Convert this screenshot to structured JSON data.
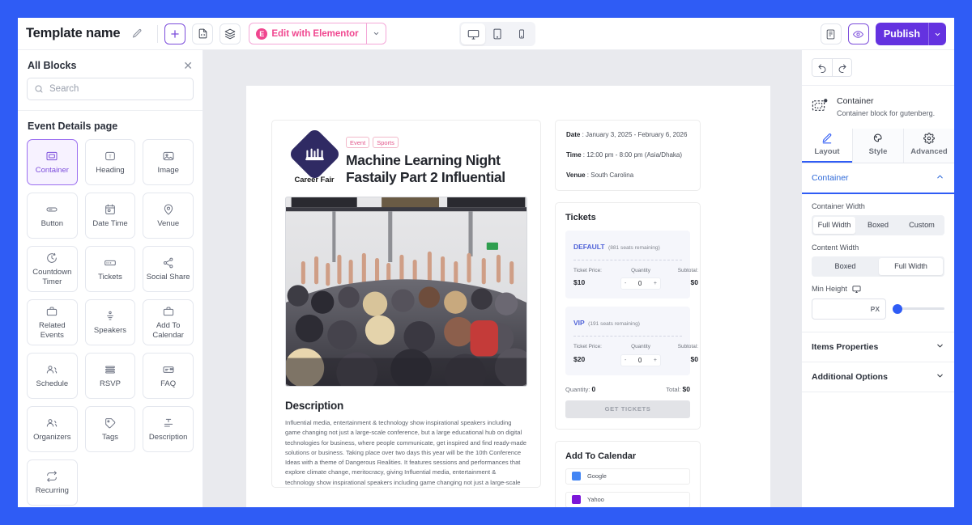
{
  "topbar": {
    "template_name": "Template name",
    "edit_pencil_icon": "pencil-icon",
    "add_icon": "plus-icon",
    "template_icon": "file-code-icon",
    "layers_icon": "layers-icon",
    "elementor_label": "Edit with Elementor",
    "elementor_badge": "E",
    "elementor_caret_icon": "chevron-down-icon",
    "devices": [
      {
        "name": "desktop",
        "icon": "desktop-icon",
        "active": true
      },
      {
        "name": "tablet",
        "icon": "tablet-icon",
        "active": false
      },
      {
        "name": "mobile",
        "icon": "mobile-icon",
        "active": false
      }
    ],
    "list_view_icon": "list-view-icon",
    "preview_icon": "eye-icon",
    "publish_label": "Publish",
    "publish_caret_icon": "chevron-down-icon",
    "accent_purple": "#6432e0",
    "accent_pink": "#f0468f"
  },
  "left_sidebar": {
    "title": "All Blocks",
    "close_icon": "close-icon",
    "search": {
      "placeholder": "Search",
      "value": "",
      "icon": "search-icon"
    },
    "section_title": "Event Details page",
    "blocks": [
      {
        "label": "Container",
        "icon": "container-icon",
        "active": true
      },
      {
        "label": "Heading",
        "icon": "heading-icon",
        "active": false
      },
      {
        "label": "Image",
        "icon": "image-icon",
        "active": false
      },
      {
        "label": "Button",
        "icon": "button-icon",
        "active": false
      },
      {
        "label": "Date Time",
        "icon": "calendar-icon",
        "active": false
      },
      {
        "label": "Venue",
        "icon": "pin-icon",
        "active": false
      },
      {
        "label": "Countdown Timer",
        "icon": "clock-icon",
        "active": false
      },
      {
        "label": "Tickets",
        "icon": "ticket-icon",
        "active": false
      },
      {
        "label": "Social Share",
        "icon": "share-icon",
        "active": false
      },
      {
        "label": "Related Events",
        "icon": "briefcase-icon",
        "active": false
      },
      {
        "label": "Speakers",
        "icon": "speaker-icon",
        "active": false
      },
      {
        "label": "Add To Calendar",
        "icon": "briefcase-icon",
        "active": false
      },
      {
        "label": "Schedule",
        "icon": "people-icon",
        "active": false
      },
      {
        "label": "RSVP",
        "icon": "list-icon",
        "active": false
      },
      {
        "label": "FAQ",
        "icon": "faq-icon",
        "active": false
      },
      {
        "label": "Organizers",
        "icon": "people-icon",
        "active": false
      },
      {
        "label": "Tags",
        "icon": "tag-icon",
        "active": false
      },
      {
        "label": "Description",
        "icon": "text-icon",
        "active": false
      },
      {
        "label": "Recurring",
        "icon": "repeat-icon",
        "active": false
      }
    ]
  },
  "canvas": {
    "event": {
      "logo_text": "Career Fair",
      "logo_icon": "crown-diamond-logo",
      "tags": [
        "Event",
        "Sports"
      ],
      "title": "Machine Learning Night Fastaily Part 2 Influential",
      "photo_alt": "conference-audience-raised-hands",
      "description_heading": "Description",
      "description_body": "Influential media, entertainment & technology show inspirational speakers including game changing not just a large-scale conference, but a large educational hub on digital technologies for business, where people communicate, get inspired and find ready-made solutions or business. Taking place over two days this year will be the 10th Conference Ideas with a theme of Dangerous Realities. It features sessions and performances that explore climate change, meritocracy, giving Influential media, entertainment & technology show inspirational speakers including game changing not just a large-scale conference, but a large educational hub on digital technologies for business, where people communicate, get inspired and find ready-made solutions or business."
    },
    "details": {
      "date_label": "Date",
      "date_value": "January 3, 2025 - February 6, 2026",
      "time_label": "Time",
      "time_value": "12:00 pm - 8:00 pm (Asia/Dhaka)",
      "venue_label": "Venue",
      "venue_value": "South Carolina"
    },
    "tickets": {
      "heading": "Tickets",
      "tiers": [
        {
          "name": "DEFAULT",
          "seats": "(881 seats remaining)",
          "price_label": "Ticket Price:",
          "price": "$10",
          "quantity_label": "Quantity",
          "quantity": "0",
          "minus": "-",
          "plus": "+",
          "subtotal_label": "Subtotal:",
          "subtotal": "$0"
        },
        {
          "name": "VIP",
          "seats": "(191 seats remaining)",
          "price_label": "Ticket Price:",
          "price": "$20",
          "quantity_label": "Quantity",
          "quantity": "0",
          "minus": "-",
          "plus": "+",
          "subtotal_label": "Subtotal:",
          "subtotal": "$0"
        }
      ],
      "quantity_total_label": "Quantity:",
      "quantity_total": "0",
      "total_label": "Total:",
      "total": "$0",
      "cta": "GET TICKETS"
    },
    "calendar": {
      "heading": "Add To Calendar",
      "items": [
        {
          "label": "Google",
          "icon": "google-calendar-icon",
          "color": "#4285f4"
        },
        {
          "label": "Yahoo",
          "icon": "yahoo-calendar-icon",
          "color": "#7b16d9"
        }
      ]
    }
  },
  "right_sidebar": {
    "undo_icon": "undo-icon",
    "redo_icon": "redo-icon",
    "block": {
      "icon": "container-block-icon",
      "name": "Container",
      "description": "Container block for gutenberg."
    },
    "tabs": [
      {
        "label": "Layout",
        "icon": "pencil-icon",
        "active": true
      },
      {
        "label": "Style",
        "icon": "paint-icon",
        "active": false
      },
      {
        "label": "Advanced",
        "icon": "gear-icon",
        "active": false
      }
    ],
    "sections": [
      {
        "label": "Container",
        "expanded": true,
        "caret": "chevron-up-icon"
      },
      {
        "label": "Items Properties",
        "expanded": false,
        "caret": "chevron-down-icon"
      },
      {
        "label": "Additional Options",
        "expanded": false,
        "caret": "chevron-down-icon"
      }
    ],
    "container_width": {
      "label": "Container Width",
      "options": [
        "Full Width",
        "Boxed",
        "Custom"
      ],
      "selected": "Full Width"
    },
    "content_width": {
      "label": "Content Width",
      "options": [
        "Boxed",
        "Full Width"
      ],
      "selected": "Full Width"
    },
    "min_height": {
      "label": "Min Height",
      "device_icon": "desktop-icon",
      "unit": "PX",
      "value": ""
    },
    "accent_blue": "#2f5cf5"
  }
}
